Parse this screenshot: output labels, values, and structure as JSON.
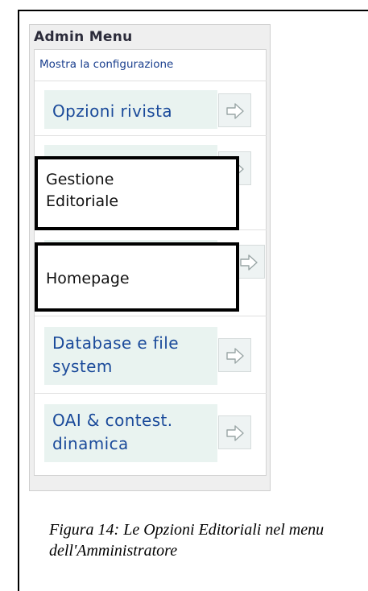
{
  "admin_menu": {
    "title": "Admin Menu",
    "config_link": "Mostra la configurazione",
    "items": [
      {
        "label_lines": [
          "Opzioni rivista"
        ],
        "highlighted": false
      },
      {
        "label_lines": [
          "Gestione",
          "Editoriale"
        ],
        "highlighted": true
      },
      {
        "label_lines": [
          "Homepage"
        ],
        "highlighted": true
      },
      {
        "label_lines": [
          "Database e file",
          "system"
        ],
        "highlighted": false
      },
      {
        "label_lines": [
          "OAI & contest.",
          "dinamica"
        ],
        "highlighted": false
      }
    ],
    "arrow_icon": "arrow-right-icon"
  },
  "caption": "Figura 14: Le Opzioni Editoriali nel menu dell'Amministratore",
  "colors": {
    "link": "#1a3f8e",
    "item_background": "#e9f3f0",
    "panel_background": "#efefef",
    "highlight_border": "#000000"
  }
}
